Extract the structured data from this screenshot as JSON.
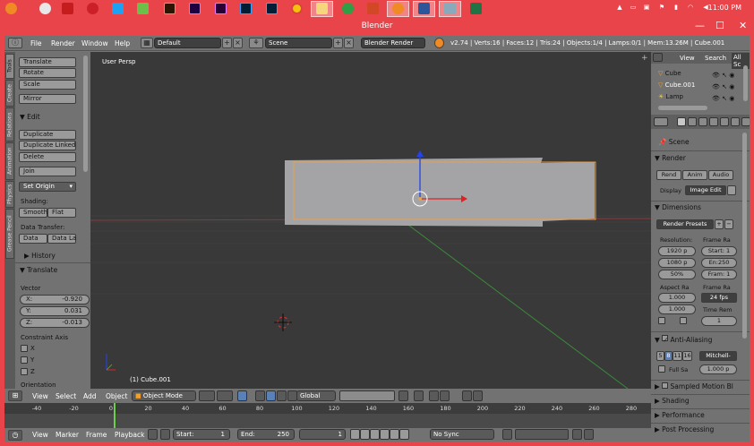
{
  "taskbar": {
    "icons": [
      "blender-icon",
      "chrome-small-icon",
      "acrobat-icon",
      "pinterest-icon",
      "twitter-icon",
      "notepad-icon",
      "illustrator-icon",
      "after-effects-icon",
      "premiere-icon",
      "photoshop-icon",
      "lightroom-icon",
      "chrome-icon",
      "file-explorer-icon",
      "green-app-icon",
      "powerpoint-icon",
      "blender-active-icon",
      "word-icon",
      "photos-icon",
      "excel-icon"
    ],
    "clock": "11:00 PM",
    "colors": {
      "bar": "#e8444a"
    }
  },
  "window": {
    "title": "Blender",
    "minimize": "—",
    "maximize": "☐",
    "close": "✕"
  },
  "info_header": {
    "menus": [
      "File",
      "Render",
      "Window",
      "Help"
    ],
    "layout": "Default",
    "scene": "Scene",
    "engine": "Blender Render",
    "stats": "v2.74 | Verts:16 | Faces:12 | Tris:24 | Objects:1/4 | Lamps:0/1 | Mem:13.26M | Cube.001"
  },
  "tool_tabs": [
    "Tools",
    "Create",
    "Relations",
    "Animation",
    "Physics",
    "Grease Pencil"
  ],
  "tool_shelf": {
    "transform": [
      "Translate",
      "Rotate",
      "Scale"
    ],
    "mirror": "Mirror",
    "edit_header": "Edit",
    "edit": [
      "Duplicate",
      "Duplicate Linked",
      "Delete"
    ],
    "join": "Join",
    "set_origin": "Set Origin",
    "shading_label": "Shading:",
    "shading": [
      "Smooth",
      "Flat"
    ],
    "data_transfer_label": "Data Transfer:",
    "data_transfer": [
      "Data",
      "Data La"
    ],
    "history": "History",
    "operator": "Translate",
    "vector_label": "Vector",
    "vector": [
      {
        "axis": "X:",
        "value": "-0.920"
      },
      {
        "axis": "Y:",
        "value": "0.031"
      },
      {
        "axis": "Z:",
        "value": "-0.013"
      }
    ],
    "constraint_label": "Constraint Axis",
    "constraints": [
      "X",
      "Y",
      "Z"
    ],
    "orientation_label": "Orientation"
  },
  "viewport": {
    "view_name": "User Persp",
    "object_label": "(1) Cube.001"
  },
  "viewport_header": {
    "menus": [
      "View",
      "Select",
      "Add",
      "Object"
    ],
    "mode": "Object Mode",
    "orientation": "Global"
  },
  "timeline": {
    "ticks": [
      "-40",
      "-20",
      "0",
      "20",
      "40",
      "60",
      "80",
      "100",
      "120",
      "140",
      "160",
      "180",
      "200",
      "220",
      "240",
      "260",
      "280"
    ],
    "menus": [
      "View",
      "Marker",
      "Frame",
      "Playback"
    ],
    "start": "Start:",
    "start_val": "1",
    "end": "End:",
    "end_val": "250",
    "current": "1",
    "sync": "No Sync"
  },
  "outliner": {
    "menus": [
      "View",
      "Search",
      "All Sc"
    ],
    "items": [
      "Cube",
      "Cube.001",
      "Lamp"
    ]
  },
  "properties": {
    "scene": "Scene",
    "render_header": "Render",
    "render_buttons": [
      "Rend",
      "Anim",
      "Audio"
    ],
    "display_label": "Display",
    "display_value": "Image Edit",
    "dimensions_header": "Dimensions",
    "render_presets": "Render Presets",
    "resolution_label": "Resolution:",
    "res_x": "1920 p",
    "res_y": "1080 p",
    "res_pct": "50%",
    "frame_range_label": "Frame Ra",
    "start": "Start: 1",
    "end": "En:250",
    "frame_step": "Fram: 1",
    "aspect_label": "Aspect Ra",
    "aspect_x": "1.000",
    "aspect_y": "1.000",
    "frame_rate_label": "Frame Ra",
    "fps": "24 fps",
    "time_remap_label": "Time Rem",
    "time_remap": "1",
    "aa_header": "Anti-Aliasing",
    "aa_samples": [
      "5",
      "8",
      "11",
      "16"
    ],
    "aa_filter": "Mitchell-",
    "full_sample": "Full Sa",
    "filter_size": "1.000 p",
    "collapsed": [
      "Sampled Motion Bl",
      "Shading",
      "Performance",
      "Post Processing"
    ]
  }
}
